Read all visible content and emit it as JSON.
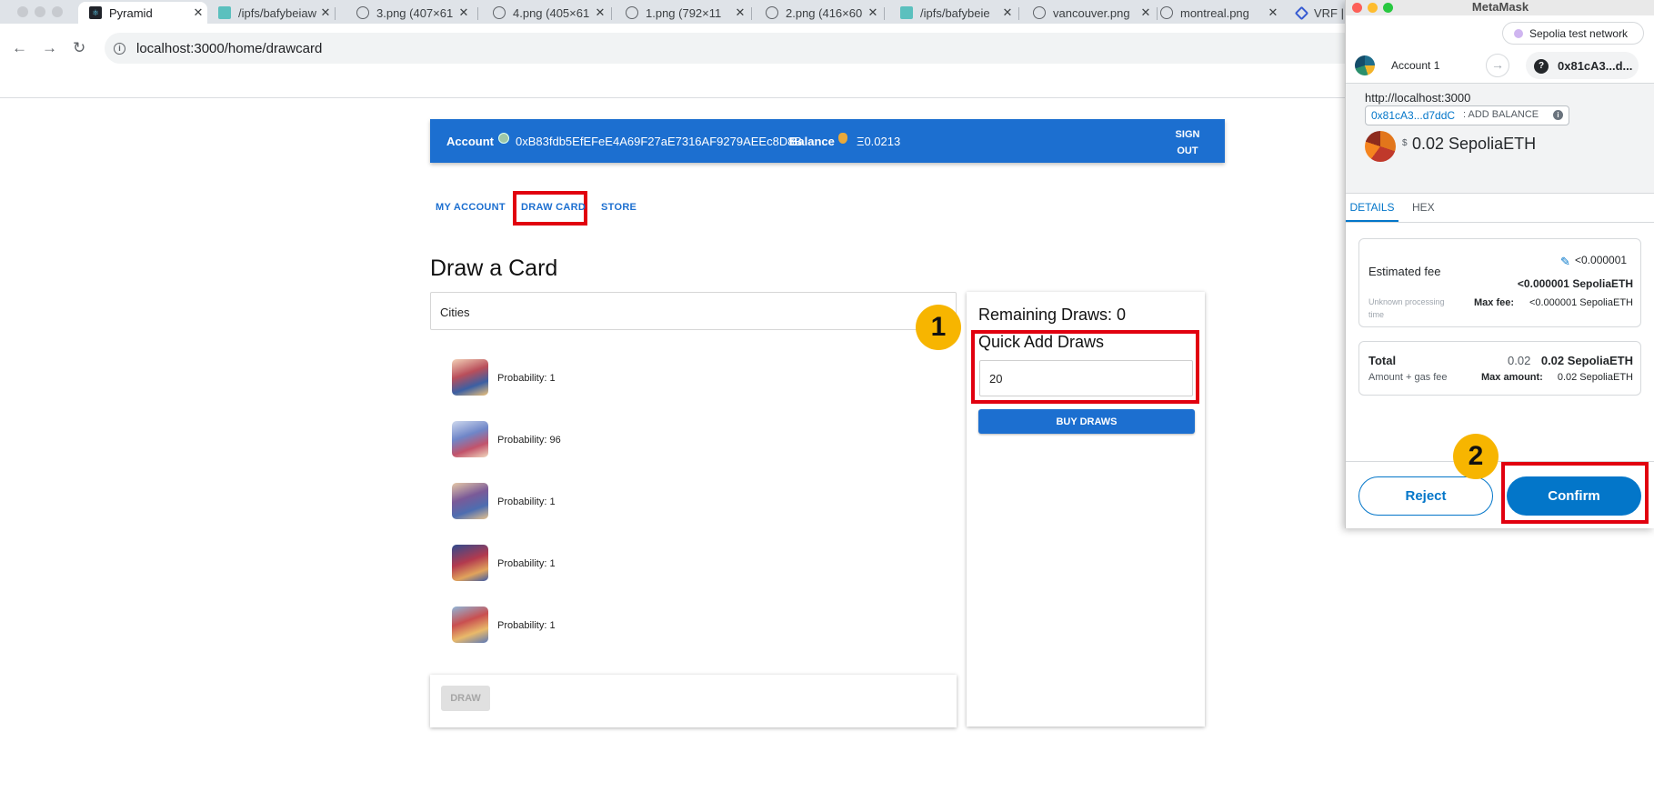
{
  "browser": {
    "tabs": [
      {
        "title": "Pyramid",
        "active": true,
        "icon": "react-icon"
      },
      {
        "title": "/ipfs/bafybeiaw",
        "icon": "ipfs-cube-icon"
      },
      {
        "title": "3.png (407×61",
        "icon": "globe-icon"
      },
      {
        "title": "4.png (405×61",
        "icon": "globe-icon"
      },
      {
        "title": "1.png (792×11",
        "icon": "globe-icon"
      },
      {
        "title": "2.png (416×60",
        "icon": "globe-icon"
      },
      {
        "title": "/ipfs/bafybeie",
        "icon": "ipfs-cube-icon"
      },
      {
        "title": "vancouver.png",
        "icon": "globe-icon"
      },
      {
        "title": "montreal.png",
        "icon": "globe-icon"
      },
      {
        "title": "VRF | ",
        "icon": "chainlink-icon"
      }
    ],
    "close_glyph": "✕",
    "url": "localhost:3000/home/drawcard"
  },
  "app": {
    "header": {
      "account_label": "Account",
      "account_address": "0xB83fdb5EfEFeE4A69F27aE7316AF9279AEEc8D8B",
      "balance_label": "Balance",
      "balance_value": "Ξ0.0213",
      "sign_out": "SIGN OUT"
    },
    "nav": {
      "my_account": "MY ACCOUNT",
      "draw_card": "DRAW CARD",
      "store": "STORE"
    },
    "page_title": "Draw a Card",
    "collection": "Cities",
    "cards": [
      {
        "probability": "Probability: 1"
      },
      {
        "probability": "Probability: 96"
      },
      {
        "probability": "Probability: 1"
      },
      {
        "probability": "Probability: 1"
      },
      {
        "probability": "Probability: 1"
      }
    ],
    "draw_button": "DRAW",
    "side": {
      "remaining": "Remaining Draws: 0",
      "quick_add": "Quick Add Draws",
      "draws_value": "20",
      "buy_button": "BUY DRAWS"
    }
  },
  "annotations": {
    "step1": "1",
    "step2": "2"
  },
  "metamask": {
    "title": "MetaMask",
    "network": "Sepolia test network",
    "account": "Account 1",
    "to_address": "0x81cA3...d...",
    "origin": "http://localhost:3000",
    "contract_short": "0x81cA3...d7ddC",
    "contract_action": ": ADD BALANCE",
    "amount_prefix": "$",
    "amount": "0.02 SepoliaETH",
    "tabs": [
      "DETAILS",
      "HEX"
    ],
    "estimated_fee_label": "Estimated fee",
    "estimated_fee_small": "<0.000001",
    "estimated_fee_value": "<0.000001 SepoliaETH",
    "processing_time": "Unknown processing time",
    "max_fee_label": "Max fee:",
    "max_fee_value": "<0.000001 SepoliaETH",
    "total_label": "Total",
    "total_small": "0.02",
    "total_value": "0.02 SepoliaETH",
    "amount_gas": "Amount + gas fee",
    "max_amount_label": "Max amount:",
    "max_amount_value": "0.02 SepoliaETH",
    "reject": "Reject",
    "confirm": "Confirm"
  },
  "colors": {
    "primary": "#1c6fd0",
    "highlight": "#e1000f",
    "badge": "#f7b500",
    "metamask_blue": "#0376c9"
  }
}
